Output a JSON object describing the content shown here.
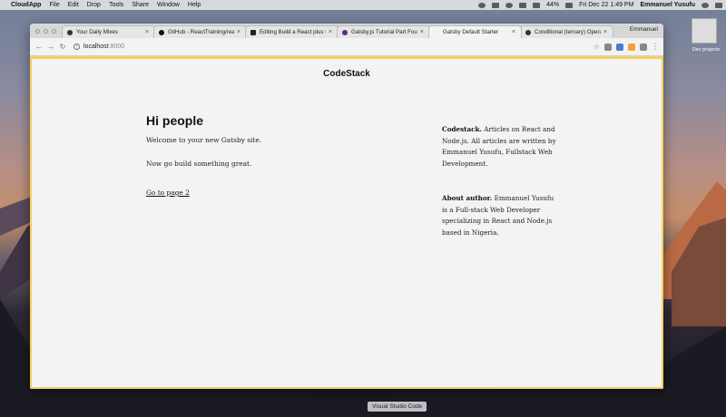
{
  "menubar": {
    "app_name": "CloudApp",
    "items": [
      "File",
      "Edit",
      "Drop",
      "Tools",
      "Share",
      "Window",
      "Help"
    ],
    "battery": "44%",
    "datetime": "Fri Dec 22  1:49 PM",
    "user": "Emmanuel Yusufu"
  },
  "desktop": {
    "icon_label": "Dev projects"
  },
  "browser": {
    "tabs": [
      {
        "title": "Your Daily Mixes",
        "icon": "music-icon",
        "active": false
      },
      {
        "title": "GitHub - ReactTraining/rea",
        "icon": "github-icon",
        "active": false
      },
      {
        "title": "Editing Build a React plus G",
        "icon": "medium-icon",
        "active": false
      },
      {
        "title": "Gatsby.js Tutorial Part Four",
        "icon": "gatsby-icon",
        "active": false
      },
      {
        "title": "Gatsby Default Starter",
        "icon": "none",
        "active": true
      },
      {
        "title": "Conditional (ternary) Opera",
        "icon": "mdn-icon",
        "active": false
      }
    ],
    "profile_name": "Emmanuel",
    "url_host": "localhost",
    "url_port": ":8000"
  },
  "page": {
    "site_title": "CodeStack",
    "heading": "Hi people",
    "welcome": "Welcome to your new Gatsby site.",
    "tagline": "Now go build something great.",
    "link": "Go to page 2",
    "about_site_label": "Codestack.",
    "about_site_text": "Articles on React and Node.js. All articles are written by Emmanuel Yusufu, Fullstack Web Development.",
    "about_author_label": "About author.",
    "about_author_text": "Emmanuel Yusufu is a Full-stack Web Developer specializing in React and Node.js based in Nigeria."
  },
  "dock": {
    "hover_label": "Visual Studio Code"
  }
}
